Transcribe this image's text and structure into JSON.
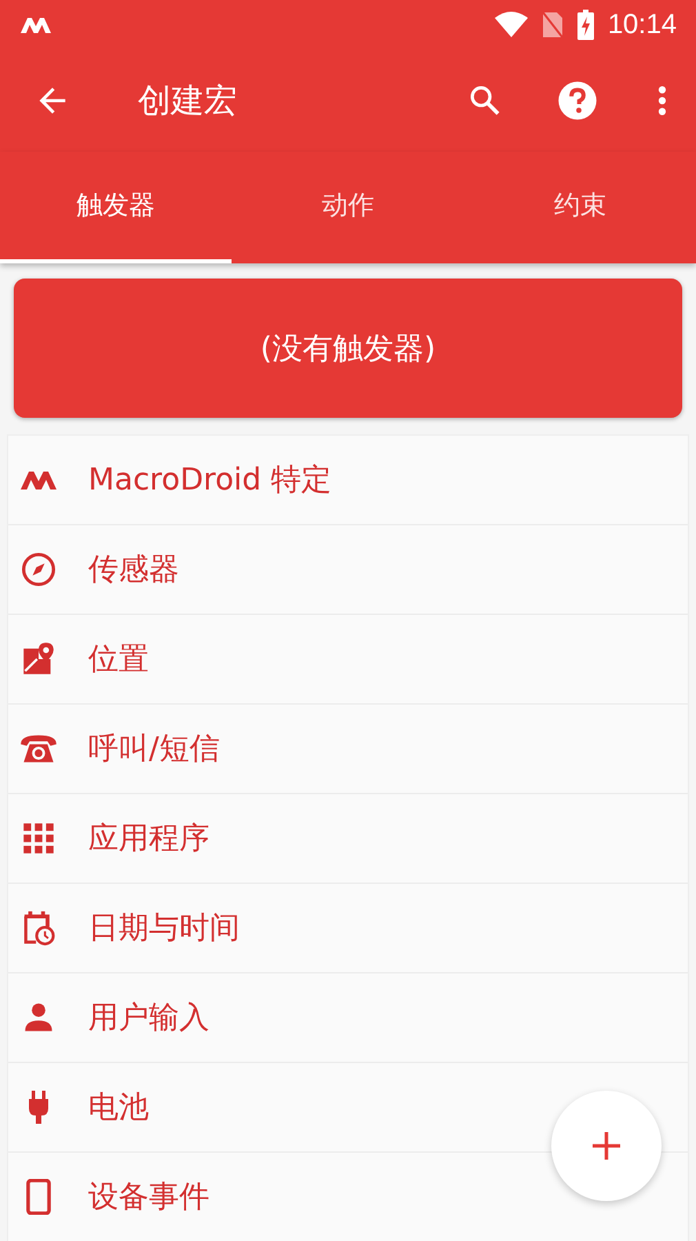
{
  "status_bar": {
    "time": "10:14"
  },
  "app_bar": {
    "title": "创建宏"
  },
  "tabs": [
    {
      "label": "触发器",
      "selected": true
    },
    {
      "label": "动作",
      "selected": false
    },
    {
      "label": "约束",
      "selected": false
    }
  ],
  "empty_banner": "(没有触发器)",
  "categories": [
    {
      "label": "MacroDroid 特定"
    },
    {
      "label": "传感器"
    },
    {
      "label": "位置"
    },
    {
      "label": "呼叫/短信"
    },
    {
      "label": "应用程序"
    },
    {
      "label": "日期与时间"
    },
    {
      "label": "用户输入"
    },
    {
      "label": "电池"
    },
    {
      "label": "设备事件"
    }
  ]
}
